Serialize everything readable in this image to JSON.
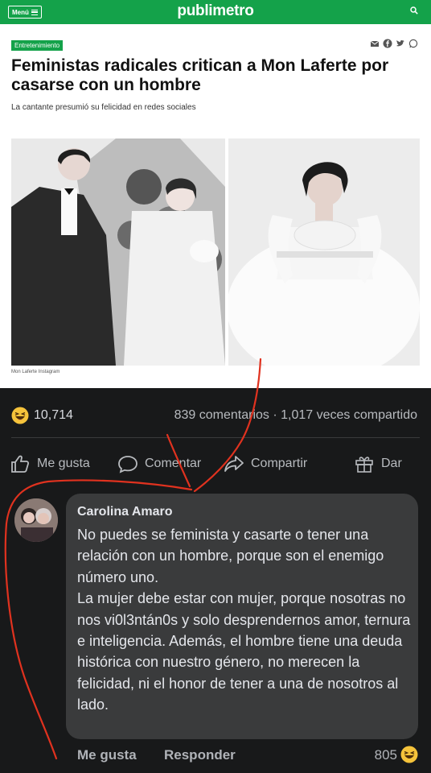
{
  "site": {
    "menu_label": "Menú",
    "logo": "publimetro"
  },
  "article": {
    "category": "Entretenimiento",
    "headline": "Feministas radicales critican a Mon Laferte por casarse con un hombre",
    "subheadline": "La cantante presumió su felicidad en redes sociales",
    "photo_caption": "Mon Laferte Instagram"
  },
  "post_stats": {
    "reaction_count": "10,714",
    "comments_shares": "839 comentarios · 1,017 veces compartido"
  },
  "actions": {
    "like": "Me gusta",
    "comment": "Comentar",
    "share": "Compartir",
    "gift": "Dar"
  },
  "comment": {
    "author": "Carolina Amaro",
    "text": "No puedes se feminista y casarte o tener una relación con un hombre, porque son el enemigo número uno.\nLa mujer debe estar con mujer, porque nosotras no nos vi0l3ntán0s y solo desprendernos amor, ternura e inteligencia. Además, el hombre tiene una deuda histórica con nuestro género, no merecen la felicidad, ni el honor de tener a una de nosotros al lado.",
    "like_label": "Me gusta",
    "reply_label": "Responder",
    "reaction_count": "805"
  },
  "colors": {
    "brand_green": "#14a24a",
    "fb_dark_bg": "#18191a",
    "bubble_bg": "#3a3b3c",
    "annotation_red": "#e0321f"
  },
  "icons": [
    "menu-icon",
    "search-icon",
    "email-icon",
    "facebook-icon",
    "twitter-icon",
    "whatsapp-icon",
    "haha-emoji-icon",
    "like-icon",
    "comment-icon",
    "share-icon",
    "gift-icon"
  ]
}
